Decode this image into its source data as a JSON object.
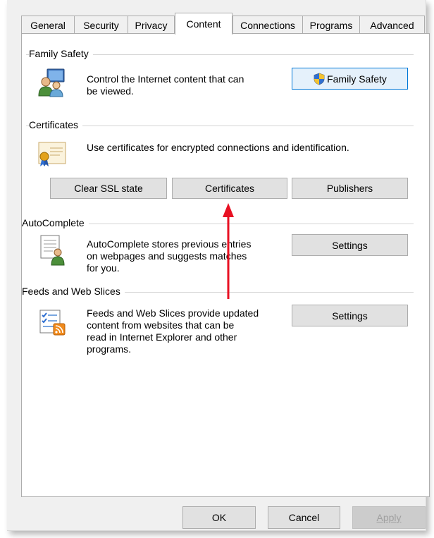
{
  "tabs": [
    {
      "label": "General",
      "active": false
    },
    {
      "label": "Security",
      "active": false
    },
    {
      "label": "Privacy",
      "active": false
    },
    {
      "label": "Content",
      "active": true
    },
    {
      "label": "Connections",
      "active": false
    },
    {
      "label": "Programs",
      "active": false
    },
    {
      "label": "Advanced",
      "active": false
    }
  ],
  "family_safety": {
    "title": "Family Safety",
    "line1": "Control the Internet content that can",
    "line2": "be viewed.",
    "button": "Family Safety",
    "button_icon": "uac-shield-icon"
  },
  "certificates": {
    "title": "Certificates",
    "description": "Use certificates for encrypted connections and identification.",
    "clear_ssl": "Clear SSL state",
    "certificates_button": "Certificates",
    "publishers": "Publishers"
  },
  "autocomplete": {
    "title": "AutoComplete",
    "line1": "AutoComplete stores previous entries",
    "line2": "on webpages and suggests matches",
    "line3": "for you.",
    "settings": "Settings"
  },
  "feeds": {
    "title": "Feeds and Web Slices",
    "line1": "Feeds and Web Slices provide updated",
    "line2": "content from websites that can be",
    "line3": "read in Internet Explorer and other",
    "line4": "programs.",
    "settings": "Settings"
  },
  "footer": {
    "ok": "OK",
    "cancel": "Cancel",
    "apply": "Apply",
    "apply_enabled": false
  },
  "annotation": {
    "arrow_color": "#e81123",
    "points_to": "Certificates"
  }
}
